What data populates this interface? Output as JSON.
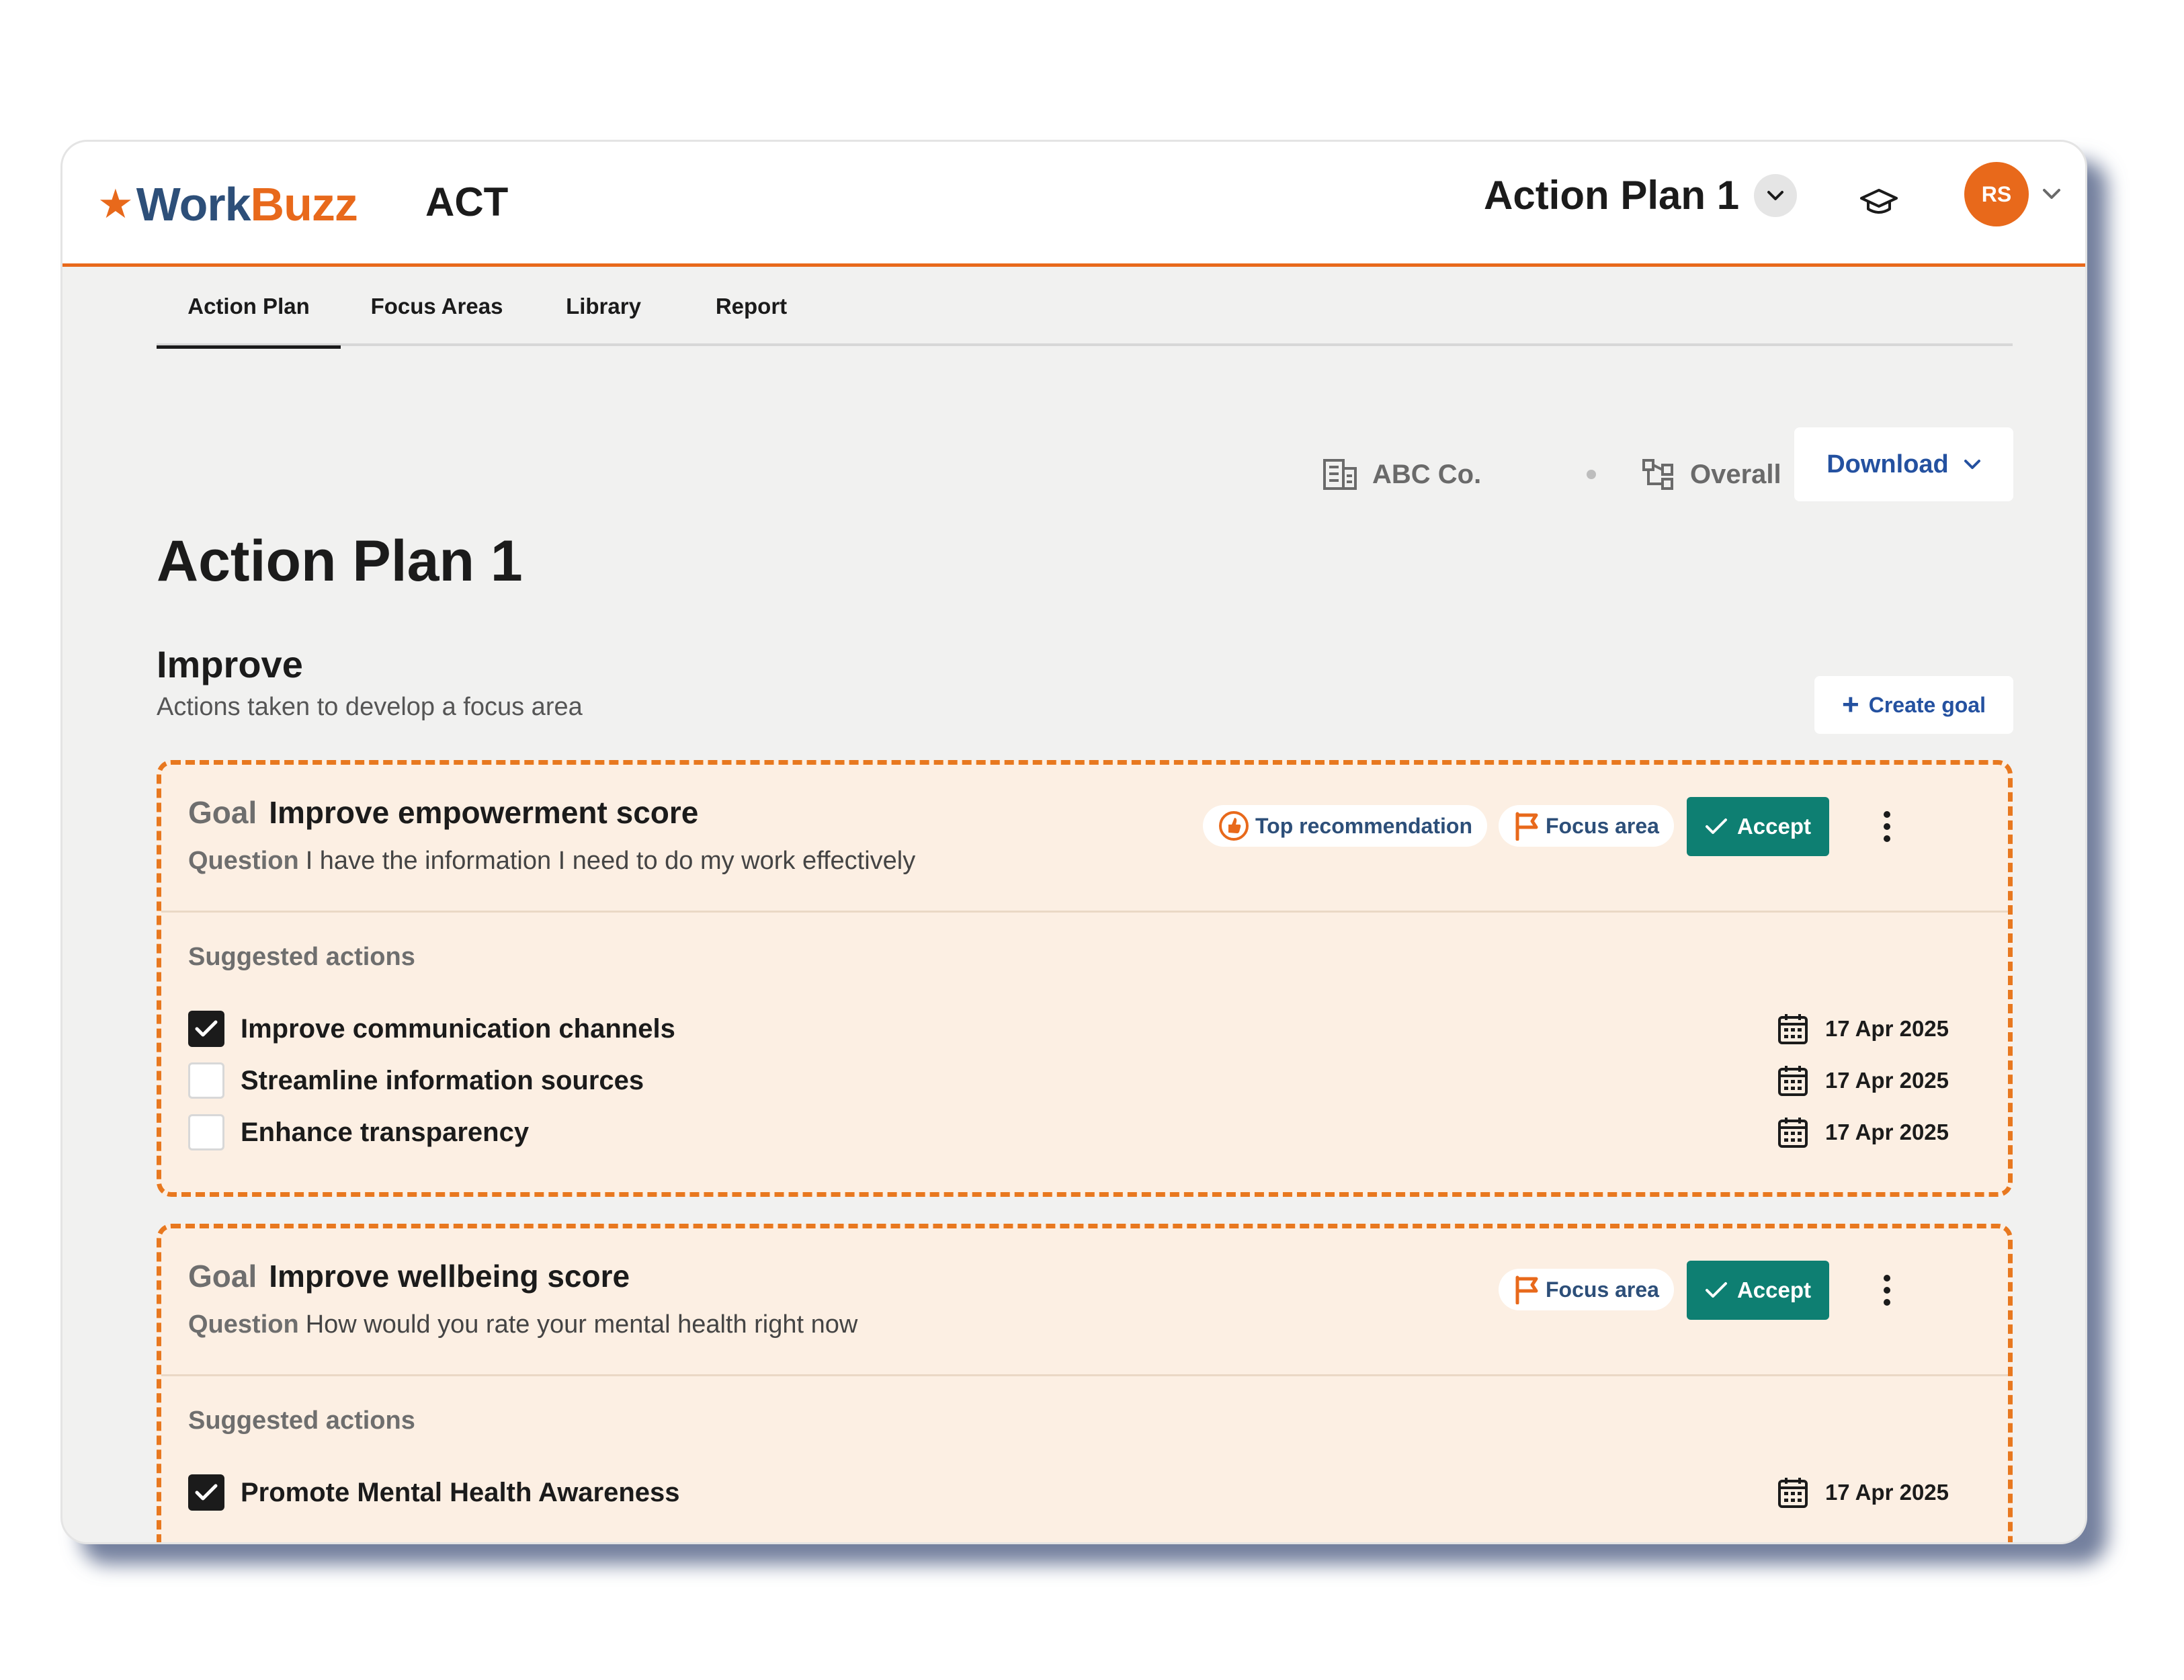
{
  "app": {
    "logo_work": "Work",
    "logo_buzz": "Buzz",
    "module": "ACT",
    "plan_selector": "Action Plan 1",
    "avatar_initials": "RS"
  },
  "colors": {
    "brand_orange": "#e8691b",
    "brand_navy": "#2d4f79",
    "link_blue": "#2451a0",
    "accept_green": "#0e7f72",
    "card_bg": "#fcefe3",
    "page_bg": "#f1f1f0"
  },
  "tabs": [
    {
      "label": "Action Plan",
      "active": true
    },
    {
      "label": "Focus Areas",
      "active": false
    },
    {
      "label": "Library",
      "active": false
    },
    {
      "label": "Report",
      "active": false
    }
  ],
  "meta": {
    "company": "ABC Co.",
    "company_icon": "building-icon",
    "scope": "Overall",
    "scope_icon": "hierarchy-icon",
    "download_label": "Download"
  },
  "page": {
    "title": "Action Plan 1",
    "section_title": "Improve",
    "section_subtitle": "Actions taken to develop a focus area",
    "create_goal_label": "Create goal"
  },
  "goals": [
    {
      "goal_keyword": "Goal",
      "title": "Improve empowerment score",
      "question_keyword": "Question",
      "question": "I have the information I need to do my work effectively",
      "badges": [
        "Top recommendation",
        "Focus area"
      ],
      "accept_label": "Accept",
      "suggested_label": "Suggested actions",
      "actions": [
        {
          "label": "Improve communication channels",
          "checked": true,
          "date": "17 Apr 2025"
        },
        {
          "label": "Streamline information sources",
          "checked": false,
          "date": "17 Apr 2025"
        },
        {
          "label": "Enhance transparency",
          "checked": false,
          "date": "17 Apr 2025"
        }
      ]
    },
    {
      "goal_keyword": "Goal",
      "title": "Improve wellbeing score",
      "question_keyword": "Question",
      "question": "How would you rate your mental health right now",
      "badges": [
        "Focus area"
      ],
      "accept_label": "Accept",
      "suggested_label": "Suggested actions",
      "actions": [
        {
          "label": "Promote Mental Health Awareness",
          "checked": true,
          "date": "17 Apr 2025"
        }
      ]
    }
  ]
}
